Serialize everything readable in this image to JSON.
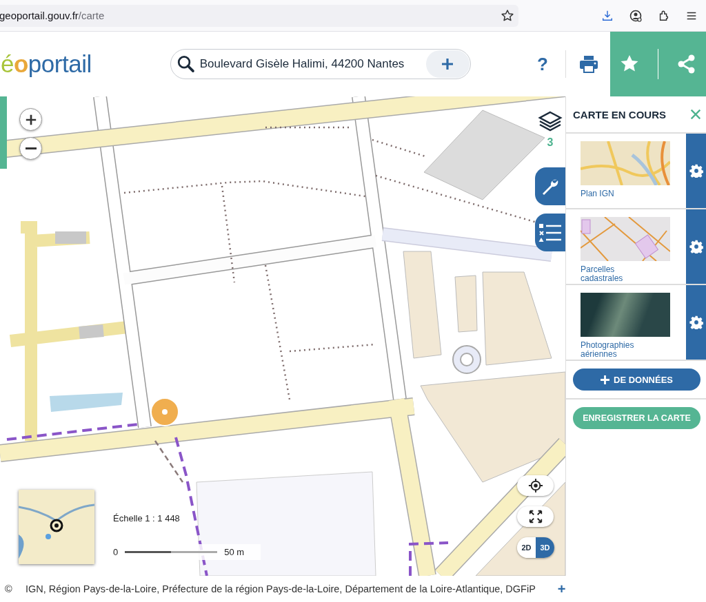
{
  "browser": {
    "url_host": "geoportail.gouv.fr",
    "url_path": "/carte"
  },
  "header": {
    "logo": [
      {
        "text": "é",
        "kind": "accent"
      },
      {
        "text": "o",
        "kind": "orange"
      },
      {
        "text": "portail",
        "kind": "main"
      }
    ],
    "search": {
      "value": "Boulevard Gisèle Halimi, 44200 Nantes"
    },
    "help": "?"
  },
  "map": {
    "layer_count": "3",
    "scale": "Échelle 1 : 1 448",
    "scale_start": "0",
    "scale_end": "50 m",
    "view_modes": [
      {
        "label": "2D",
        "selected": false
      },
      {
        "label": "3D",
        "selected": true
      }
    ]
  },
  "panel": {
    "title": "CARTE EN COURS",
    "layers": [
      {
        "name": "Plan IGN",
        "kind": "plan"
      },
      {
        "name": "Parcelles cadastrales",
        "kind": "cadastre"
      },
      {
        "name": "Photographies aériennes",
        "kind": "photo"
      }
    ],
    "add_button": "DE DONNÉES",
    "save_button": "ENREGISTRER LA CARTE"
  },
  "attribution": {
    "symbol": "©",
    "text": "IGN, Région Pays-de-la-Loire, Préfecture de la région Pays-de-la-Loire, Département de la Loire-Atlantique, DGFiP",
    "more": "+"
  }
}
